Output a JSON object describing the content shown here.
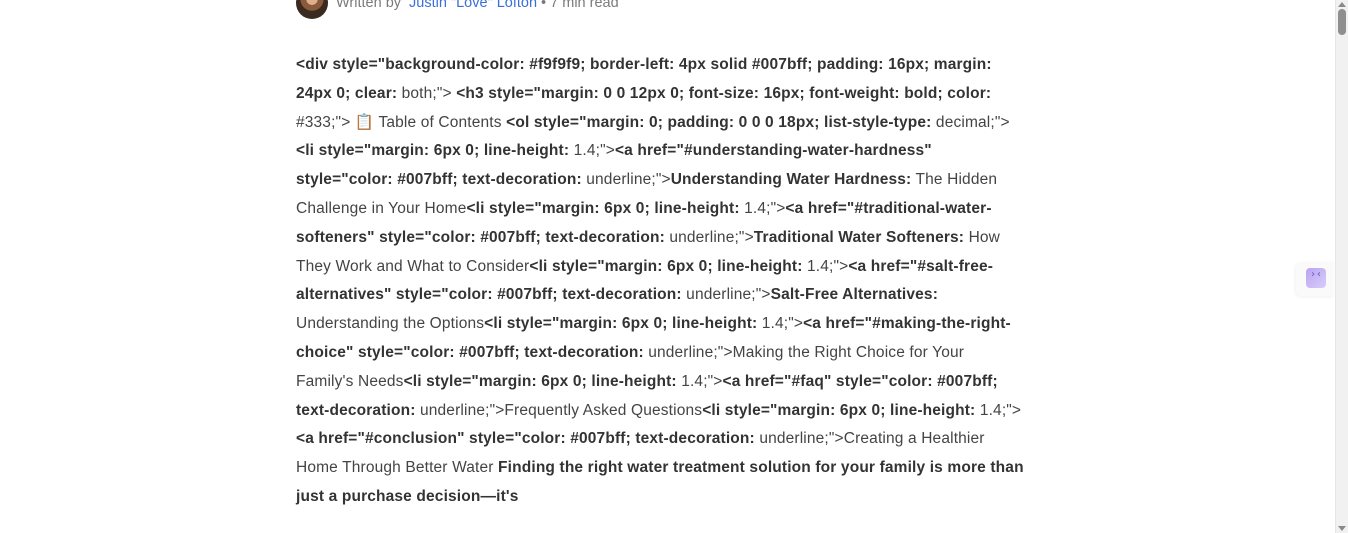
{
  "byline": {
    "written_by": "Written by",
    "author": "Justin \"Love\" Lofton",
    "read_time": " • 7 min read"
  },
  "side_widget": {
    "icon": "collapse-icon",
    "glyph": "›‹"
  },
  "article": {
    "segments": [
      {
        "t": "<div style=\"background-color: #f9f9f9; border-left: 4px solid #007bff; padding: 16px; margin: 24px 0; clear:",
        "b": true
      },
      {
        "t": " both;\"> ",
        "b": false
      },
      {
        "t": "<h3 style=\"margin: 0 0 12px 0; font-size: 16px; font-weight: bold; color:",
        "b": true
      },
      {
        "t": " #333;\"> 📋 Table of Contents ",
        "b": false
      },
      {
        "t": "<ol style=\"margin: 0; padding: 0 0 0 18px; list-style-type:",
        "b": true
      },
      {
        "t": " decimal;\"> ",
        "b": false
      },
      {
        "t": "<li style=\"margin: 6px 0; line-height:",
        "b": true
      },
      {
        "t": " 1.4;\">",
        "b": false
      },
      {
        "t": "<a href=\"#understanding-water-hardness\" style=\"color: #007bff; text-decoration:",
        "b": true
      },
      {
        "t": " underline;\">",
        "b": false
      },
      {
        "t": "Understanding Water Hardness:",
        "b": true
      },
      {
        "t": " The Hidden Challenge in Your Home",
        "b": false
      },
      {
        "t": "<li style=\"margin: 6px 0; line-height:",
        "b": true
      },
      {
        "t": " 1.4;\">",
        "b": false
      },
      {
        "t": "<a href=\"#traditional-water-softeners\" style=\"color: #007bff; text-decoration:",
        "b": true
      },
      {
        "t": " underline;\">",
        "b": false
      },
      {
        "t": "Traditional Water Softeners:",
        "b": true
      },
      {
        "t": " How They Work and What to Consider",
        "b": false
      },
      {
        "t": "<li style=\"margin: 6px 0; line-height:",
        "b": true
      },
      {
        "t": " 1.4;\">",
        "b": false
      },
      {
        "t": "<a href=\"#salt-free-alternatives\" style=\"color: #007bff; text-decoration:",
        "b": true
      },
      {
        "t": " underline;\">",
        "b": false
      },
      {
        "t": "Salt-Free Alternatives:",
        "b": true
      },
      {
        "t": " Understanding the Options",
        "b": false
      },
      {
        "t": "<li style=\"margin: 6px 0; line-height:",
        "b": true
      },
      {
        "t": " 1.4;\">",
        "b": false
      },
      {
        "t": "<a href=\"#making-the-right-choice\" style=\"color: #007bff; text-decoration:",
        "b": true
      },
      {
        "t": " underline;\">Making the Right Choice for Your Family's Needs",
        "b": false
      },
      {
        "t": "<li style=\"margin: 6px 0; line-height:",
        "b": true
      },
      {
        "t": " 1.4;\">",
        "b": false
      },
      {
        "t": "<a href=\"#faq\" style=\"color: #007bff; text-decoration:",
        "b": true
      },
      {
        "t": " underline;\">Frequently Asked Questions",
        "b": false
      },
      {
        "t": "<li style=\"margin: 6px 0; line-height:",
        "b": true
      },
      {
        "t": " 1.4;\">",
        "b": false
      },
      {
        "t": "<a href=\"#conclusion\" style=\"color: #007bff; text-decoration:",
        "b": true
      },
      {
        "t": " underline;\">Creating a Healthier Home Through Better Water ",
        "b": false
      },
      {
        "t": "Finding the right water treatment solution for your family is more than just a purchase decision—it's",
        "b": true
      }
    ]
  },
  "colors": {
    "author_link": "#3a6fd8",
    "meta_text": "#7a7a7a",
    "body_text": "#444444"
  }
}
